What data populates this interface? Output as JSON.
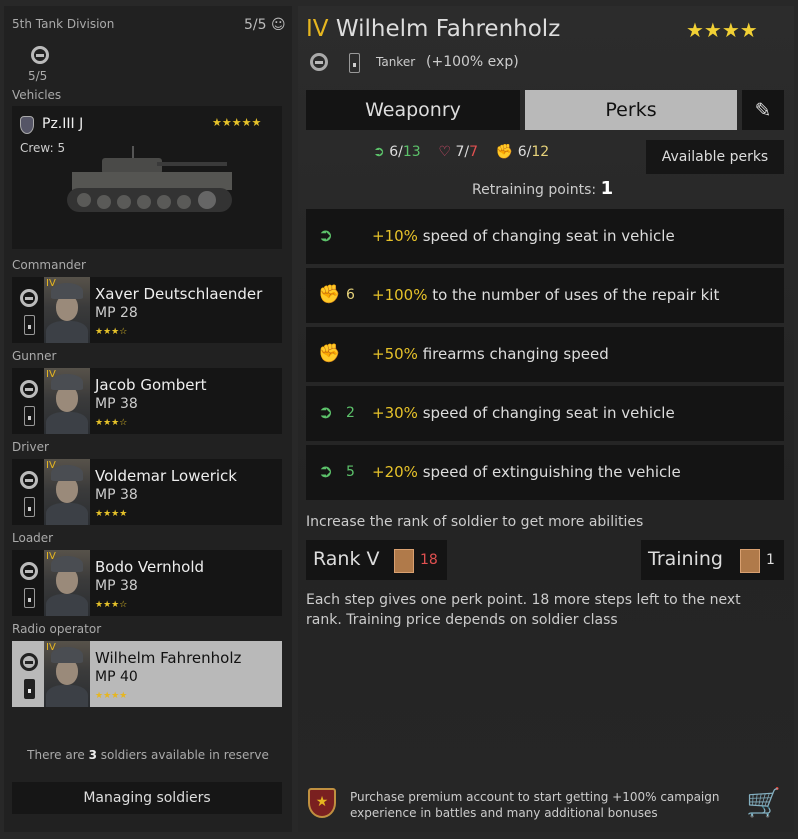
{
  "left": {
    "division": "5th Tank Division",
    "squad_count": "5/5",
    "vehicle_count": "5/5",
    "vehicles_label": "Vehicles",
    "vehicle": {
      "name": "Pz.III J",
      "stars": "★★★★★",
      "crew": "Crew: 5"
    },
    "soldiers": [
      {
        "role": "Commander",
        "rank": "IV",
        "name": "Xaver Deutschlaender",
        "mp": "MP 28",
        "stars": "★★★☆"
      },
      {
        "role": "Gunner",
        "rank": "IV",
        "name": "Jacob Gombert",
        "mp": "MP 38",
        "stars": "★★★☆"
      },
      {
        "role": "Driver",
        "rank": "IV",
        "name": "Voldemar Lowerick",
        "mp": "MP 38",
        "stars": "★★★★"
      },
      {
        "role": "Loader",
        "rank": "IV",
        "name": "Bodo Vernhold",
        "mp": "MP 38",
        "stars": "★★★☆"
      },
      {
        "role": "Radio operator",
        "rank": "IV",
        "name": "Wilhelm Fahrenholz",
        "mp": "MP 40",
        "stars": "★★★★"
      }
    ],
    "reserve_pre": "There are ",
    "reserve_count": "3",
    "reserve_post": " soldiers available in reserve",
    "manage_button": "Managing soldiers"
  },
  "right": {
    "rank": "IV",
    "name": "Wilhelm Fahrenholz",
    "stars": "★★★★",
    "class": "Tanker",
    "exp": "(+100% exp)",
    "tabs": [
      "Weaponry",
      "Perks"
    ],
    "stats": [
      {
        "icon": "boot-icon",
        "value": "6",
        "max": "13",
        "color": "#5cc26a"
      },
      {
        "icon": "heart-icon",
        "value": "7",
        "max": "7",
        "color": "#e05050"
      },
      {
        "icon": "fist-icon",
        "value": "6",
        "max": "12",
        "color": "#e6d27a"
      }
    ],
    "available_perks": "Available perks",
    "retraining_label": "Retraining points:",
    "retraining_value": "1",
    "perks": [
      {
        "icon": "boot-icon",
        "num": "",
        "value": "+10%",
        "text": " speed of changing seat in vehicle"
      },
      {
        "icon": "fist-icon",
        "num": "6",
        "value": "+100%",
        "text": " to the number of uses of the repair kit"
      },
      {
        "icon": "fist-icon",
        "num": "",
        "value": "+50%",
        "text": " firearms changing speed"
      },
      {
        "icon": "boot-icon",
        "num": "2",
        "value": "+30%",
        "text": " speed of changing seat in vehicle"
      },
      {
        "icon": "boot-icon",
        "num": "5",
        "value": "+20%",
        "text": " speed of extinguishing the vehicle"
      }
    ],
    "rank_hint": "Increase the rank of soldier to get more abilities",
    "rank_button": "Rank V",
    "rank_cost": "18",
    "training_button": "Training",
    "training_cost": "1",
    "description": "Each step gives one perk point. 18 more steps left to the next rank. Training price depends on soldier class",
    "premium_text": "Purchase premium account to start getting +100% campaign experience in battles and many additional bonuses"
  },
  "colors": {
    "accent": "#e6b620",
    "green": "#5cc26a",
    "red": "#e05050",
    "selected": "#b9b9b9"
  }
}
